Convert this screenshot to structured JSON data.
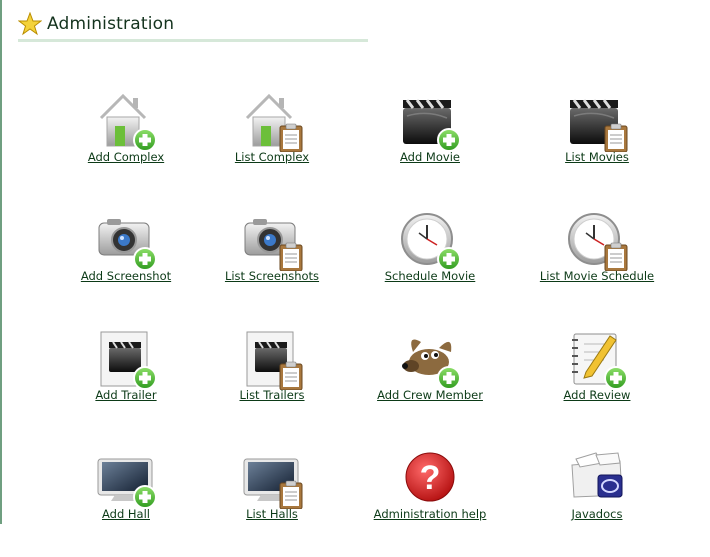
{
  "header": {
    "title": "Administration"
  },
  "items": [
    {
      "label": "Add Complex",
      "icon": "house-add-icon"
    },
    {
      "label": "List Complex",
      "icon": "house-list-icon"
    },
    {
      "label": "Add Movie",
      "icon": "clapper-add-icon"
    },
    {
      "label": "List Movies",
      "icon": "clapper-list-icon"
    },
    {
      "label": "Add Screenshot",
      "icon": "camera-add-icon"
    },
    {
      "label": "List Screenshots",
      "icon": "camera-list-icon"
    },
    {
      "label": "Schedule Movie",
      "icon": "clock-add-icon"
    },
    {
      "label": "List Movie Schedule",
      "icon": "clock-list-icon"
    },
    {
      "label": "Add Trailer",
      "icon": "trailer-add-icon"
    },
    {
      "label": "List Trailers",
      "icon": "trailer-list-icon"
    },
    {
      "label": "Add Crew Member",
      "icon": "gimp-mascot-add-icon"
    },
    {
      "label": "Add Review",
      "icon": "notebook-pencil-add-icon"
    },
    {
      "label": "Add Hall",
      "icon": "screen-add-icon"
    },
    {
      "label": "List Halls",
      "icon": "screen-list-icon"
    },
    {
      "label": "Administration help",
      "icon": "help-icon"
    },
    {
      "label": "Javadocs",
      "icon": "javadocs-icon"
    }
  ],
  "colors": {
    "link": "#0c3a17",
    "underline": "#d6e8d9",
    "add_badge": "#3fae2a",
    "help": "#cc1f1f"
  }
}
